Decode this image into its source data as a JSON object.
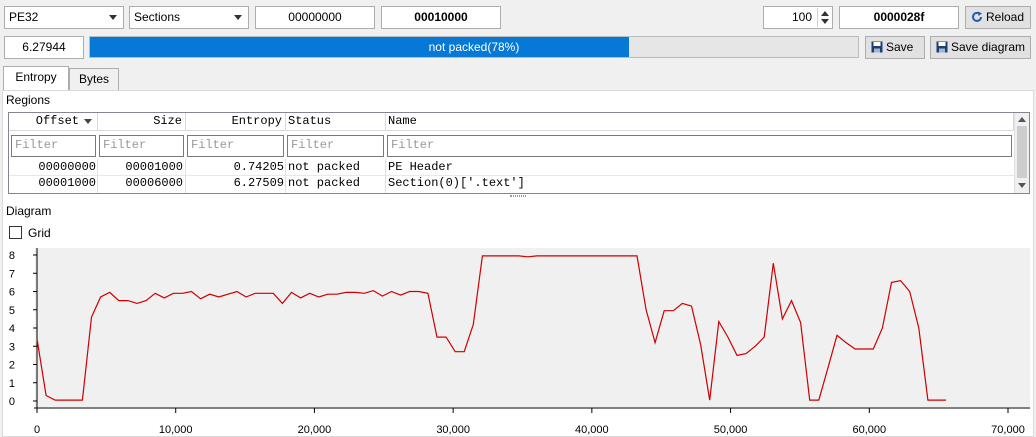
{
  "toolbar": {
    "filetype": "PE32",
    "mode": "Sections",
    "start_address": "00000000",
    "end_address": "00010000",
    "block_count": "100",
    "block_size": "0000028f",
    "reload_label": "Reload"
  },
  "status": {
    "total_entropy": "6.27944",
    "progress_text": "not packed(78%)",
    "progress_fraction": 0.78,
    "save_label": "Save",
    "save_diagram_label": "Save diagram"
  },
  "tabs": [
    "Entropy",
    "Bytes"
  ],
  "regions": {
    "label": "Regions",
    "columns": [
      "Offset",
      "Size",
      "Entropy",
      "Status",
      "Name"
    ],
    "filter_placeholder": "Filter",
    "rows": [
      {
        "offset": "00000000",
        "size": "00001000",
        "entropy": "0.74205",
        "status": "not packed",
        "name": "PE Header"
      },
      {
        "offset": "00001000",
        "size": "00006000",
        "entropy": "6.27509",
        "status": "not packed",
        "name": "Section(0)['.text']"
      }
    ]
  },
  "diagram": {
    "label": "Diagram",
    "grid_label": "Grid",
    "grid_checked": false
  },
  "chart_data": {
    "type": "line",
    "color": "#cc0000",
    "xlim": [
      0,
      70000
    ],
    "ylim": [
      0,
      8
    ],
    "xticks": [
      "0",
      "10,000",
      "20,000",
      "30,000",
      "40,000",
      "50,000",
      "60,000",
      "70,000"
    ],
    "yticks": [
      "0",
      "1",
      "2",
      "3",
      "4",
      "5",
      "6",
      "7",
      "8"
    ],
    "x": [
      0,
      655,
      1310,
      1966,
      2621,
      3276,
      3932,
      4587,
      5242,
      5898,
      6553,
      7208,
      7864,
      8519,
      9174,
      9830,
      10485,
      11140,
      11796,
      12451,
      13106,
      13762,
      14417,
      15072,
      15728,
      16383,
      17038,
      17694,
      18349,
      19004,
      19660,
      20315,
      20970,
      21626,
      22281,
      22936,
      23592,
      24247,
      24902,
      25558,
      26213,
      26868,
      27524,
      28179,
      28834,
      29490,
      30145,
      30800,
      31456,
      32111,
      32766,
      33422,
      34077,
      34732,
      35388,
      36043,
      36698,
      37354,
      38009,
      38664,
      39320,
      39975,
      40630,
      41286,
      41941,
      42596,
      43252,
      43907,
      44562,
      45218,
      45873,
      46528,
      47184,
      47839,
      48494,
      49150,
      49805,
      50460,
      51116,
      51771,
      52426,
      53082,
      53737,
      54392,
      55048,
      55703,
      56358,
      57014,
      57669,
      58324,
      58980,
      59635,
      60290,
      60946,
      61601,
      62256,
      62912,
      63567,
      64222,
      64878,
      65533
    ],
    "y": [
      3.4,
      0.3,
      0.05,
      0.05,
      0.05,
      0.05,
      4.6,
      5.7,
      5.95,
      5.5,
      5.5,
      5.35,
      5.5,
      5.9,
      5.65,
      5.9,
      5.9,
      6.0,
      5.6,
      5.85,
      5.7,
      5.85,
      6.0,
      5.7,
      5.9,
      5.9,
      5.9,
      5.35,
      5.95,
      5.65,
      5.9,
      5.7,
      5.85,
      5.85,
      5.95,
      5.95,
      5.9,
      6.05,
      5.75,
      6.0,
      5.8,
      6.0,
      6.0,
      5.9,
      3.5,
      3.5,
      2.7,
      2.7,
      4.2,
      7.95,
      7.95,
      7.95,
      7.95,
      7.95,
      7.9,
      7.95,
      7.95,
      7.95,
      7.95,
      7.95,
      7.95,
      7.95,
      7.95,
      7.95,
      7.95,
      7.95,
      7.95,
      5.0,
      3.2,
      4.95,
      4.95,
      5.35,
      5.2,
      3.1,
      0.05,
      4.35,
      3.5,
      2.5,
      2.6,
      3.0,
      3.5,
      7.55,
      4.5,
      5.5,
      4.3,
      0.05,
      0.05,
      1.8,
      3.6,
      3.2,
      2.85,
      2.85,
      2.85,
      4.0,
      6.5,
      6.6,
      6.0,
      4.0,
      0.05,
      0.05,
      0.05
    ]
  }
}
